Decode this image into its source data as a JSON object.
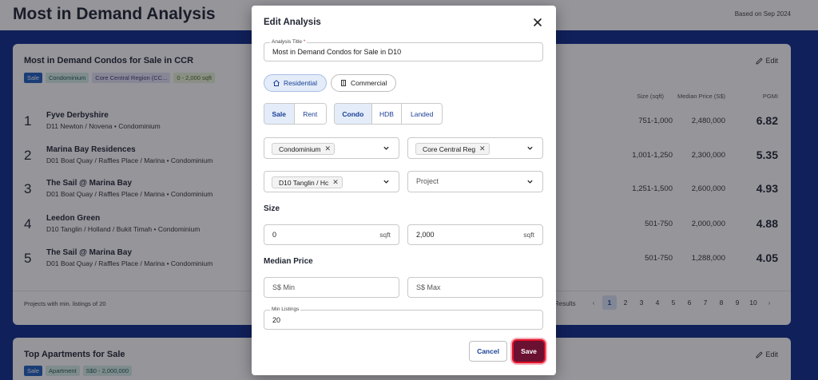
{
  "page": {
    "title": "Most in Demand Analysis",
    "based_on": "Based on Sep 2024"
  },
  "card1": {
    "title": "Most in Demand Condos for Sale in CCR",
    "edit_label": "Edit",
    "tags": [
      "Sale",
      "Condominium",
      "Core Central Region (CC...",
      "0 - 2,000 sqft"
    ],
    "columns": {
      "size": "Size (sqft)",
      "price": "Median Price (S$)",
      "pgmi": "PGMI"
    },
    "rows": [
      {
        "rank": "1",
        "name": "Fyve Derbyshire",
        "location": "D11 Newton / Novena",
        "type": "• Condominium",
        "size": "751-1,000",
        "price": "2,480,000",
        "pgmi": "6.82"
      },
      {
        "rank": "2",
        "name": "Marina Bay Residences",
        "location": "D01 Boat Quay / Raffles Place / Marina",
        "type": "• Condominium",
        "size": "1,001-1,250",
        "price": "2,300,000",
        "pgmi": "5.35"
      },
      {
        "rank": "3",
        "name": "The Sail @ Marina Bay",
        "location": "D01 Boat Quay / Raffles Place / Marina",
        "type": "• Condominium",
        "size": "1,251-1,500",
        "price": "2,600,000",
        "pgmi": "4.93"
      },
      {
        "rank": "4",
        "name": "Leedon Green",
        "location": "D10 Tanglin / Holland / Bukit Timah",
        "type": "• Condominium",
        "size": "501-750",
        "price": "2,000,000",
        "pgmi": "4.88"
      },
      {
        "rank": "5",
        "name": "The Sail @ Marina Bay",
        "location": "D01 Boat Quay / Raffles Place / Marina",
        "type": "• Condominium",
        "size": "501-750",
        "price": "1,288,000",
        "pgmi": "4.05"
      }
    ],
    "footer": "Projects with min. listings of 20",
    "results_label": "Results",
    "pages": [
      "‹",
      "1",
      "2",
      "3",
      "4",
      "5",
      "6",
      "7",
      "8",
      "9",
      "10",
      "›"
    ],
    "active_page": "1"
  },
  "card2": {
    "title": "Top Apartments for Sale",
    "edit_label": "Edit",
    "tags": [
      "Sale",
      "Apartment",
      "S$0 - 2,000,000"
    ]
  },
  "modal": {
    "title": "Edit Analysis",
    "analysis_title_label": "Analysis Title",
    "required_mark": "*",
    "analysis_title_value": "Most in Demand Condos for Sale in D10",
    "property_types": [
      "Residential",
      "Commercial"
    ],
    "property_type_selected": "Residential",
    "listing_types": [
      "Sale",
      "Rent"
    ],
    "listing_type_selected": "Sale",
    "categories": [
      "Condo",
      "HDB",
      "Landed"
    ],
    "category_selected": "Condo",
    "property_subtype_chip": "Condominium",
    "region_chip": "Core Central Reg",
    "district_chip": "D10 Tanglin / Hc",
    "project_placeholder": "Project",
    "chip_remove": "✕",
    "size_label": "Size",
    "size_min": "0",
    "size_max": "2,000",
    "size_unit": "sqft",
    "price_label": "Median Price",
    "price_min_placeholder": "S$ Min",
    "price_max_placeholder": "S$ Max",
    "min_listings_label": "Min Listings",
    "min_listings_value": "20",
    "cancel_label": "Cancel",
    "save_label": "Save"
  },
  "colors": {
    "page_background": "#0d2a8a",
    "accent": "#1a3f96",
    "save_button": "#6a1030",
    "highlight_ring": "#e0102a"
  }
}
